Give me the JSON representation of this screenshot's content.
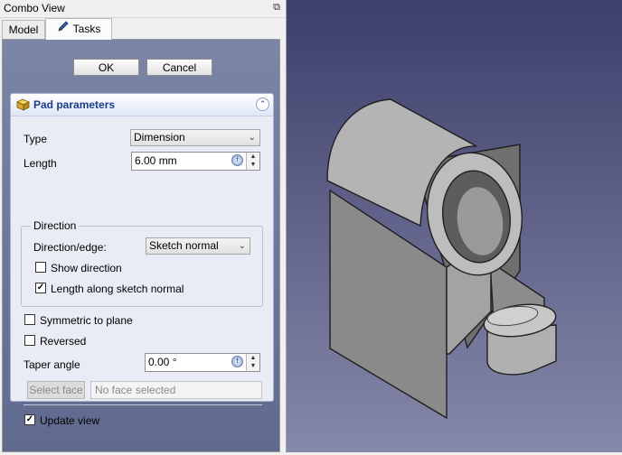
{
  "combo_view": {
    "title": "Combo View",
    "float_icon": "float-icon",
    "tabs": [
      {
        "label": "Model"
      },
      {
        "label": "Tasks",
        "icon": "pen-icon"
      }
    ]
  },
  "actions": {
    "ok_label": "OK",
    "cancel_label": "Cancel"
  },
  "pad_parameters": {
    "title": "Pad parameters",
    "header_icon": "pad-icon",
    "collapse_icon": "collapse-icon",
    "type_label": "Type",
    "type_value": "Dimension",
    "length_label": "Length",
    "length_value": "6.00 mm",
    "direction": {
      "group_title": "Direction",
      "edge_label": "Direction/edge:",
      "edge_value": "Sketch normal",
      "show_direction_label": "Show direction",
      "show_direction_checked": false,
      "along_normal_label": "Length along sketch normal",
      "along_normal_checked": true
    },
    "symmetric_label": "Symmetric to plane",
    "symmetric_checked": false,
    "reversed_label": "Reversed",
    "reversed_checked": false,
    "taper_label": "Taper angle",
    "taper_value": "0.00 °",
    "select_face_label": "Select face",
    "face_placeholder": "No face selected",
    "update_view_label": "Update view",
    "update_view_checked": true
  },
  "colors": {
    "task_panel_top": "#7b85a6",
    "task_panel_bottom": "#606a8e",
    "header_text": "#1a3e8c",
    "viewport_top": "#3d3f6c",
    "viewport_bottom": "#8688a9",
    "part_fill": "#b4b4b4"
  }
}
